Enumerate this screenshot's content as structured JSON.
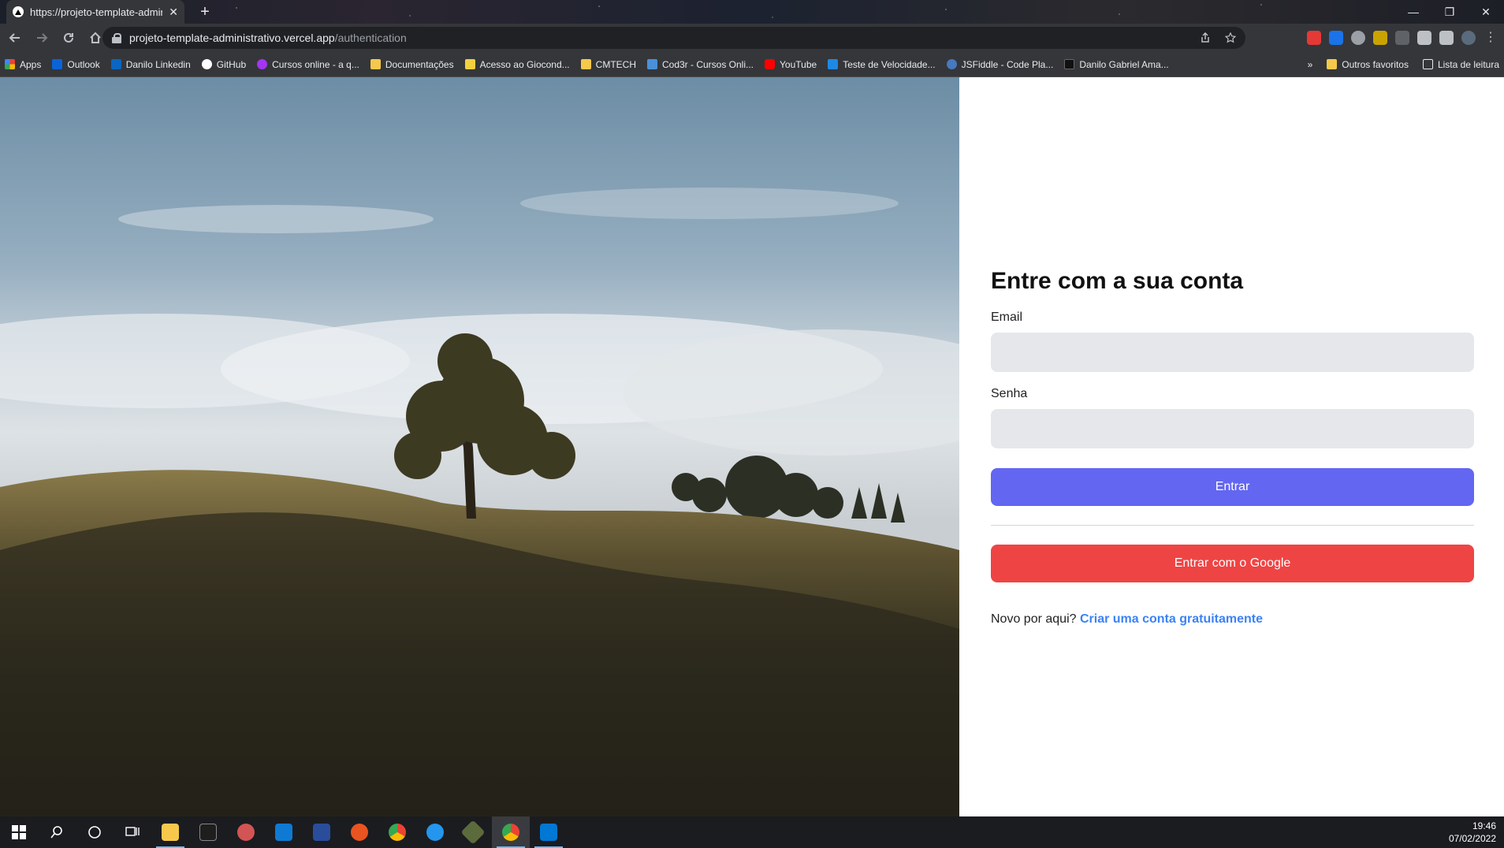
{
  "browser": {
    "tab_title": "https://projeto-template-admin",
    "tab_close": "✕",
    "new_tab": "+",
    "url_host": "projeto-template-administrativo.vercel.app",
    "url_path": "/authentication",
    "window_controls": {
      "minimize": "—",
      "restore": "❐",
      "close": "✕"
    }
  },
  "bookmarks": {
    "items": [
      {
        "label": "Apps",
        "icon": "apps-grid-icon",
        "color": "#ea4335"
      },
      {
        "label": "Outlook",
        "icon": "outlook-icon",
        "color": "#0a64d8"
      },
      {
        "label": "Danilo Linkedin",
        "icon": "linkedin-icon",
        "color": "#0a66c2"
      },
      {
        "label": "GitHub",
        "icon": "github-icon",
        "color": "#ffffff"
      },
      {
        "label": "Cursos online - a q...",
        "icon": "udemy-icon",
        "color": "#a435f0"
      },
      {
        "label": "Documentações",
        "icon": "folder-icon",
        "color": "#f6c94c"
      },
      {
        "label": "Acesso ao Giocond...",
        "icon": "giocondo-icon",
        "color": "#f4d03f"
      },
      {
        "label": "CMTECH",
        "icon": "folder-icon",
        "color": "#f6c94c"
      },
      {
        "label": "Cod3r - Cursos Onli...",
        "icon": "cod3r-icon",
        "color": "#4a90d9"
      },
      {
        "label": "YouTube",
        "icon": "youtube-icon",
        "color": "#ff0000"
      },
      {
        "label": "Teste de Velocidade...",
        "icon": "speedtest-icon",
        "color": "#1e88e5"
      },
      {
        "label": "JSFiddle - Code Pla...",
        "icon": "jsfiddle-icon",
        "color": "#4679bd"
      },
      {
        "label": "Danilo Gabriel Ama...",
        "icon": "profile-icon",
        "color": "#111111"
      }
    ],
    "more": "»",
    "other_favorites": "Outros favoritos",
    "reading_list": "Lista de leitura"
  },
  "auth": {
    "heading": "Entre com a sua conta",
    "email_label": "Email",
    "password_label": "Senha",
    "submit_label": "Entrar",
    "google_label": "Entrar com o Google",
    "signup_prompt": "Novo por aqui?",
    "signup_link": "Criar uma conta gratuitamente"
  },
  "colors": {
    "primary": "#6366f1",
    "google": "#ef4444",
    "link": "#3b82f6",
    "input_bg": "#e5e7eb"
  },
  "taskbar": {
    "time": "19:46",
    "date": "07/02/2022"
  }
}
